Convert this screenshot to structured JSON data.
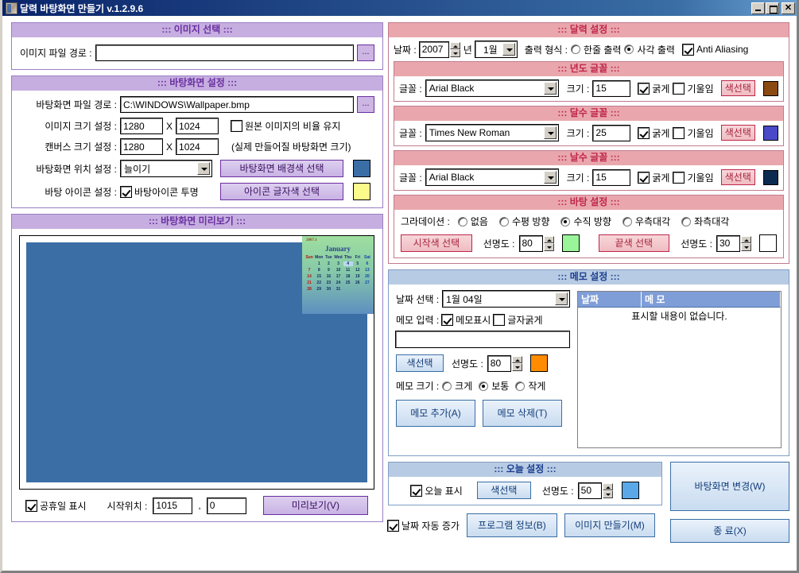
{
  "window": {
    "title": "달력 바탕화면 만들기 v.1.2.9.6",
    "minimize": "_",
    "maximize": "□",
    "close": "✕"
  },
  "image_select": {
    "header": "::: 이미지 선택 :::",
    "path_label": "이미지 파일 경로 :",
    "path_value": "",
    "browse_label": "..."
  },
  "wallpaper": {
    "header": "::: 바탕화면 설정 :::",
    "path_label": "바탕화면 파일 경로 :",
    "path_value": "C:\\WINDOWS\\Wallpaper.bmp",
    "browse_label": "...",
    "image_size_label": "이미지 크기 설정 :",
    "image_w": "1280",
    "image_h": "1024",
    "keep_ratio_label": "원본 이미지의 비율 유지",
    "keep_ratio_checked": false,
    "canvas_size_label": "캔버스 크기 설정 :",
    "canvas_w": "1280",
    "canvas_h": "1024",
    "canvas_note": "(실제 만들어질 바탕화면 크기)",
    "position_label": "바탕화면 위치 설정 :",
    "position_value": "늘이기",
    "bgcolor_button": "바탕화면 배경색 선택",
    "bgcolor_swatch": "#3b6ea5",
    "icon_label": "바탕 아이콘 설정 :",
    "icon_transparent_label": "바탕아이콘 투명",
    "icon_transparent_checked": true,
    "iconcolor_button": "아이콘 글자색 선택",
    "iconcolor_swatch": "#fbfb8c",
    "multiply_symbol": "X"
  },
  "preview": {
    "header": "::: 바탕화면 미리보기 :::",
    "holiday_label": "공휴일 표시",
    "holiday_checked": true,
    "start_pos_label": "시작위치 :",
    "start_x": "1015",
    "start_y": "0",
    "comma": ",",
    "preview_button": "미리보기(V)",
    "cal_year": "2007.1",
    "cal_month": "January",
    "daynames": [
      "Sun",
      "Mon",
      "Tue",
      "Wed",
      "Thu",
      "Fri",
      "Sat"
    ],
    "days": [
      "",
      "1",
      "2",
      "3",
      "4",
      "5",
      "6",
      "7",
      "8",
      "9",
      "10",
      "11",
      "12",
      "13",
      "14",
      "15",
      "16",
      "17",
      "18",
      "19",
      "20",
      "21",
      "22",
      "23",
      "24",
      "25",
      "26",
      "27",
      "28",
      "29",
      "30",
      "31"
    ],
    "today": "4"
  },
  "calendar": {
    "header": "::: 달력 설정 :::",
    "date_label": "날짜 :",
    "year_value": "2007",
    "year_suffix": "년",
    "month_value": "1월",
    "output_label": "출력 형식 :",
    "output_one_line": "한줄 출력",
    "output_square": "사각 출력",
    "output_selected": "사각 출력",
    "anti_aliasing_label": "Anti Aliasing",
    "anti_aliasing_checked": true
  },
  "font_year": {
    "header": "::: 년도 글꼴 :::",
    "font_label": "글꼴 :",
    "font_value": "Arial Black",
    "size_label": "크기 :",
    "size_value": "15",
    "bold_label": "굵게",
    "bold_checked": true,
    "italic_label": "기울임",
    "italic_checked": false,
    "color_button": "색선택",
    "color_swatch": "#8a4a12"
  },
  "font_month": {
    "header": "::: 달수 글꼴 :::",
    "font_label": "글꼴 :",
    "font_value": "Times New Roman",
    "size_label": "크기 :",
    "size_value": "25",
    "bold_label": "굵게",
    "bold_checked": true,
    "italic_label": "기울임",
    "italic_checked": false,
    "color_button": "색선택",
    "color_swatch": "#4a4ac8"
  },
  "font_day": {
    "header": "::: 날수 글꼴 :::",
    "font_label": "글꼴 :",
    "font_value": "Arial Black",
    "size_label": "크기 :",
    "size_value": "15",
    "bold_label": "굵게",
    "bold_checked": true,
    "italic_label": "기울임",
    "italic_checked": false,
    "color_button": "색선택",
    "color_swatch": "#0b2a50"
  },
  "background": {
    "header": "::: 바탕 설정 :::",
    "gradient_label": "그라데이션 :",
    "options": [
      "없음",
      "수평 방향",
      "수직 방향",
      "우측대각",
      "좌측대각"
    ],
    "selected": "수직 방향",
    "start_button": "시작색 선택",
    "start_opacity_label": "선명도 :",
    "start_opacity": "80",
    "start_swatch": "#9af59a",
    "end_button": "끝색 선택",
    "end_opacity_label": "선명도 :",
    "end_opacity": "30",
    "end_swatch": "#ffffff"
  },
  "memo": {
    "header": "::: 메모 설정 :::",
    "date_select_label": "날짜 선택 :",
    "date_select_value": "1월 04일",
    "input_label": "메모 입력 :",
    "show_memo_label": "메모표시",
    "show_memo_checked": true,
    "bold_text_label": "글자굵게",
    "bold_text_checked": false,
    "memo_value": "",
    "color_button": "색선택",
    "opacity_label": "선명도 :",
    "opacity_value": "80",
    "color_swatch": "#ff8c00",
    "size_label": "메모 크기 :",
    "size_options": [
      "크게",
      "보통",
      "작게"
    ],
    "size_selected": "보통",
    "add_button": "메모 추가(A)",
    "delete_button": "메모 삭제(T)",
    "list_col_date": "날짜",
    "list_col_memo": "메 모",
    "list_empty": "표시할 내용이 없습니다."
  },
  "today_settings": {
    "header": "::: 오늘 설정 :::",
    "show_today_label": "오늘 표시",
    "show_today_checked": true,
    "color_button": "색선택",
    "opacity_label": "선명도 :",
    "opacity_value": "50",
    "color_swatch": "#5aa8e8"
  },
  "actions": {
    "auto_increment_label": "날짜 자동 증가",
    "auto_increment_checked": true,
    "program_info": "프로그램 정보(B)",
    "make_image": "이미지 만들기(M)",
    "change_wallpaper": "바탕화면 변경(W)",
    "exit": "종 료(X)"
  }
}
